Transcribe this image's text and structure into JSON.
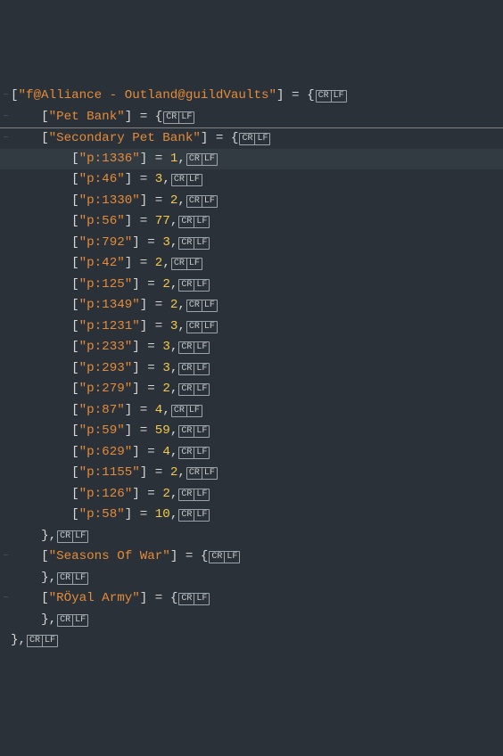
{
  "lines": [
    {
      "indent": 0,
      "fold": "−",
      "type": "key_open",
      "key": "f@Alliance - Outland@guildVaults",
      "hl": false,
      "sep": false
    },
    {
      "indent": 1,
      "fold": "−",
      "type": "key_open",
      "key": "Pet Bank",
      "hl": false,
      "sep": false
    },
    {
      "indent": 1,
      "fold": "−",
      "type": "key_open",
      "key": "Secondary Pet Bank",
      "hl": false,
      "sep": true
    },
    {
      "indent": 2,
      "fold": "",
      "type": "kv",
      "key": "p:1336",
      "val": "1",
      "hl": true,
      "sep": false
    },
    {
      "indent": 2,
      "fold": "",
      "type": "kv",
      "key": "p:46",
      "val": "3",
      "hl": false,
      "sep": false
    },
    {
      "indent": 2,
      "fold": "",
      "type": "kv",
      "key": "p:1330",
      "val": "2",
      "hl": false,
      "sep": false
    },
    {
      "indent": 2,
      "fold": "",
      "type": "kv",
      "key": "p:56",
      "val": "77",
      "hl": false,
      "sep": false
    },
    {
      "indent": 2,
      "fold": "",
      "type": "kv",
      "key": "p:792",
      "val": "3",
      "hl": false,
      "sep": false
    },
    {
      "indent": 2,
      "fold": "",
      "type": "kv",
      "key": "p:42",
      "val": "2",
      "hl": false,
      "sep": false
    },
    {
      "indent": 2,
      "fold": "",
      "type": "kv",
      "key": "p:125",
      "val": "2",
      "hl": false,
      "sep": false
    },
    {
      "indent": 2,
      "fold": "",
      "type": "kv",
      "key": "p:1349",
      "val": "2",
      "hl": false,
      "sep": false
    },
    {
      "indent": 2,
      "fold": "",
      "type": "kv",
      "key": "p:1231",
      "val": "3",
      "hl": false,
      "sep": false
    },
    {
      "indent": 2,
      "fold": "",
      "type": "kv",
      "key": "p:233",
      "val": "3",
      "hl": false,
      "sep": false
    },
    {
      "indent": 2,
      "fold": "",
      "type": "kv",
      "key": "p:293",
      "val": "3",
      "hl": false,
      "sep": false
    },
    {
      "indent": 2,
      "fold": "",
      "type": "kv",
      "key": "p:279",
      "val": "2",
      "hl": false,
      "sep": false
    },
    {
      "indent": 2,
      "fold": "",
      "type": "kv",
      "key": "p:87",
      "val": "4",
      "hl": false,
      "sep": false
    },
    {
      "indent": 2,
      "fold": "",
      "type": "kv",
      "key": "p:59",
      "val": "59",
      "hl": false,
      "sep": false
    },
    {
      "indent": 2,
      "fold": "",
      "type": "kv",
      "key": "p:629",
      "val": "4",
      "hl": false,
      "sep": false
    },
    {
      "indent": 2,
      "fold": "",
      "type": "kv",
      "key": "p:1155",
      "val": "2",
      "hl": false,
      "sep": false
    },
    {
      "indent": 2,
      "fold": "",
      "type": "kv",
      "key": "p:126",
      "val": "2",
      "hl": false,
      "sep": false
    },
    {
      "indent": 2,
      "fold": "",
      "type": "kv",
      "key": "p:58",
      "val": "10",
      "hl": false,
      "sep": false
    },
    {
      "indent": 1,
      "fold": "",
      "type": "close",
      "hl": false,
      "sep": false
    },
    {
      "indent": 1,
      "fold": "−",
      "type": "key_open",
      "key": "Seasons Of War",
      "hl": false,
      "sep": false
    },
    {
      "indent": 1,
      "fold": "",
      "type": "close",
      "hl": false,
      "sep": false
    },
    {
      "indent": 1,
      "fold": "−",
      "type": "key_open",
      "key": "RÖyal Army",
      "hl": false,
      "sep": false
    },
    {
      "indent": 1,
      "fold": "",
      "type": "close",
      "hl": false,
      "sep": false
    },
    {
      "indent": 0,
      "fold": "",
      "type": "close",
      "hl": false,
      "sep": false
    }
  ],
  "tabSize": 4,
  "eol": {
    "cr": "CR",
    "lf": "LF"
  }
}
